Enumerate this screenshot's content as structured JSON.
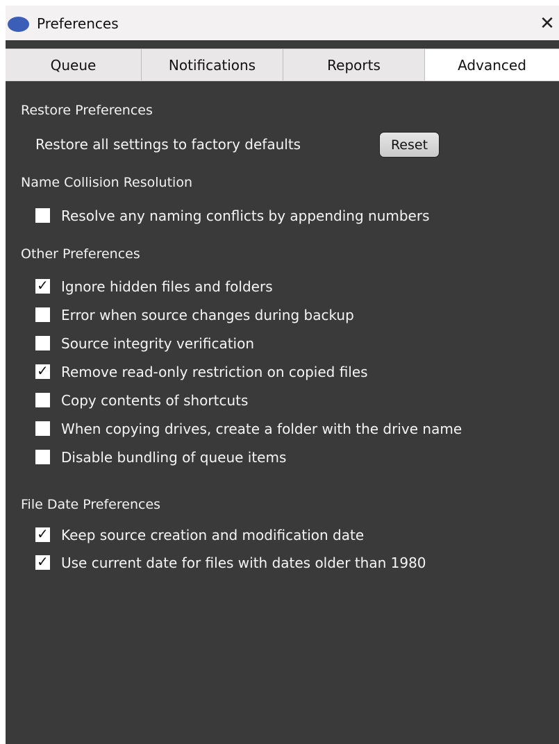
{
  "window": {
    "title": "Preferences",
    "close_symbol": "✕"
  },
  "tabs": [
    {
      "label": "Queue",
      "active": false
    },
    {
      "label": "Notifications",
      "active": false
    },
    {
      "label": "Reports",
      "active": false
    },
    {
      "label": "Advanced",
      "active": true
    }
  ],
  "restore": {
    "title": "Restore Preferences",
    "description": "Restore all settings to factory defaults",
    "button_label": "Reset"
  },
  "name_collision": {
    "title": "Name Collision Resolution",
    "options": [
      {
        "label": "Resolve any naming conflicts by appending numbers",
        "checked": false
      }
    ]
  },
  "other": {
    "title": "Other Preferences",
    "options": [
      {
        "label": "Ignore hidden files and folders",
        "checked": true
      },
      {
        "label": "Error when source changes during backup",
        "checked": false
      },
      {
        "label": "Source integrity verification",
        "checked": false
      },
      {
        "label": "Remove read-only restriction on copied files",
        "checked": true
      },
      {
        "label": "Copy contents of shortcuts",
        "checked": false
      },
      {
        "label": "When copying drives, create a folder with the drive name",
        "checked": false
      },
      {
        "label": "Disable bundling of queue items",
        "checked": false
      }
    ]
  },
  "file_date": {
    "title": "File Date Preferences",
    "options": [
      {
        "label": "Keep source creation and modification date",
        "checked": true
      },
      {
        "label": "Use current date for files with dates older than 1980",
        "checked": true
      }
    ]
  },
  "icons": {
    "app": "app-logo-icon",
    "close": "close-icon",
    "check": "checkmark-icon"
  },
  "colors": {
    "background": "#3a3a3a",
    "titlebar": "#f3f1f1",
    "app_icon": "#3b5fb6",
    "text": "#f5f5f5"
  }
}
